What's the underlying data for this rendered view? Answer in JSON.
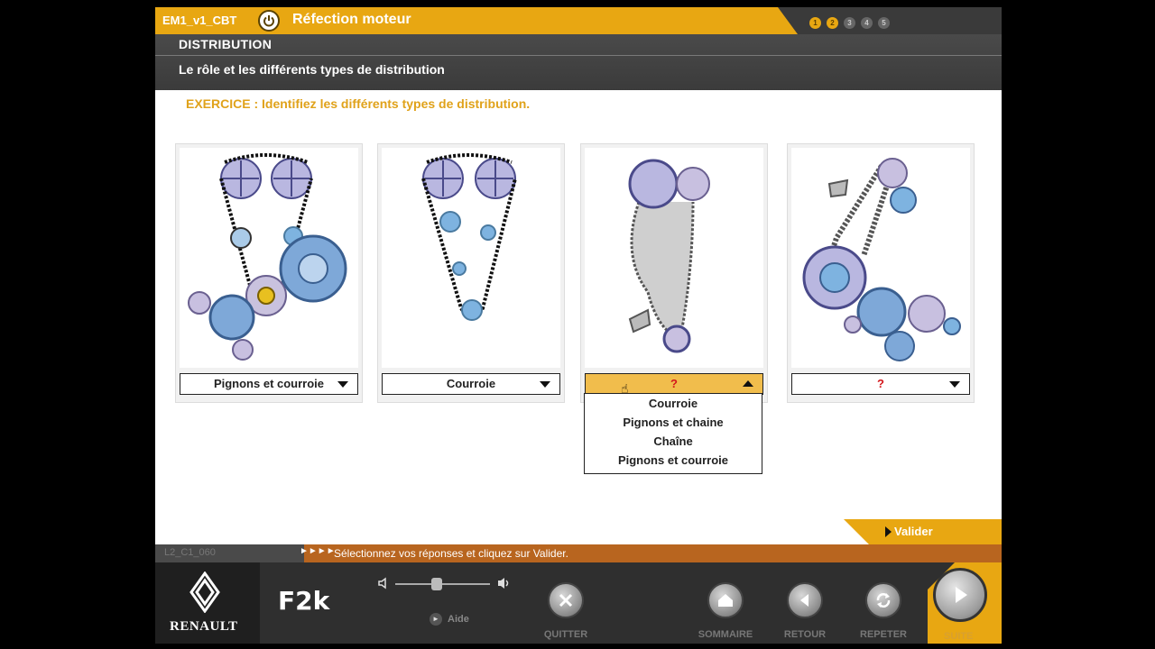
{
  "header": {
    "course_code": "EM1_v1_CBT",
    "module_title": "Réfection moteur",
    "progress_steps": [
      "1",
      "2",
      "3",
      "4",
      "5"
    ],
    "progress_done_count": 2
  },
  "section": {
    "title": "DISTRIBUTION",
    "subtitle": "Le rôle et les différents types de distribution"
  },
  "exercise": {
    "instruction": "EXERCICE : Identifiez les différents types de distribution."
  },
  "cards": [
    {
      "illustration": "pignons-et-courroie-diagram",
      "selected": "Pignons et courroie"
    },
    {
      "illustration": "courroie-diagram",
      "selected": "Courroie"
    },
    {
      "illustration": "chaine-diagram",
      "selected": "?"
    },
    {
      "illustration": "pignons-et-chaine-diagram",
      "selected": "?"
    }
  ],
  "dropdown_options": [
    "Courroie",
    "Pignons et chaine",
    "Chaîne",
    "Pignons et courroie"
  ],
  "valider_label": "Valider",
  "status": {
    "page_code": "L2_C1_060",
    "arrows": "►►►►",
    "message": "Sélectionnez vos réponses et cliquez sur Valider."
  },
  "toolbar": {
    "brand": "RENAULT",
    "f2k": "F2k",
    "aide_label": "Aide",
    "quit_label": "QUITTER",
    "sommaire_label": "SOMMAIRE",
    "retour_label": "RETOUR",
    "repeter_label": "REPETER",
    "suite_label": "SUITE"
  },
  "colors": {
    "accent": "#e8a712",
    "status_orange": "#b8651f",
    "question_red": "#d4161b"
  }
}
